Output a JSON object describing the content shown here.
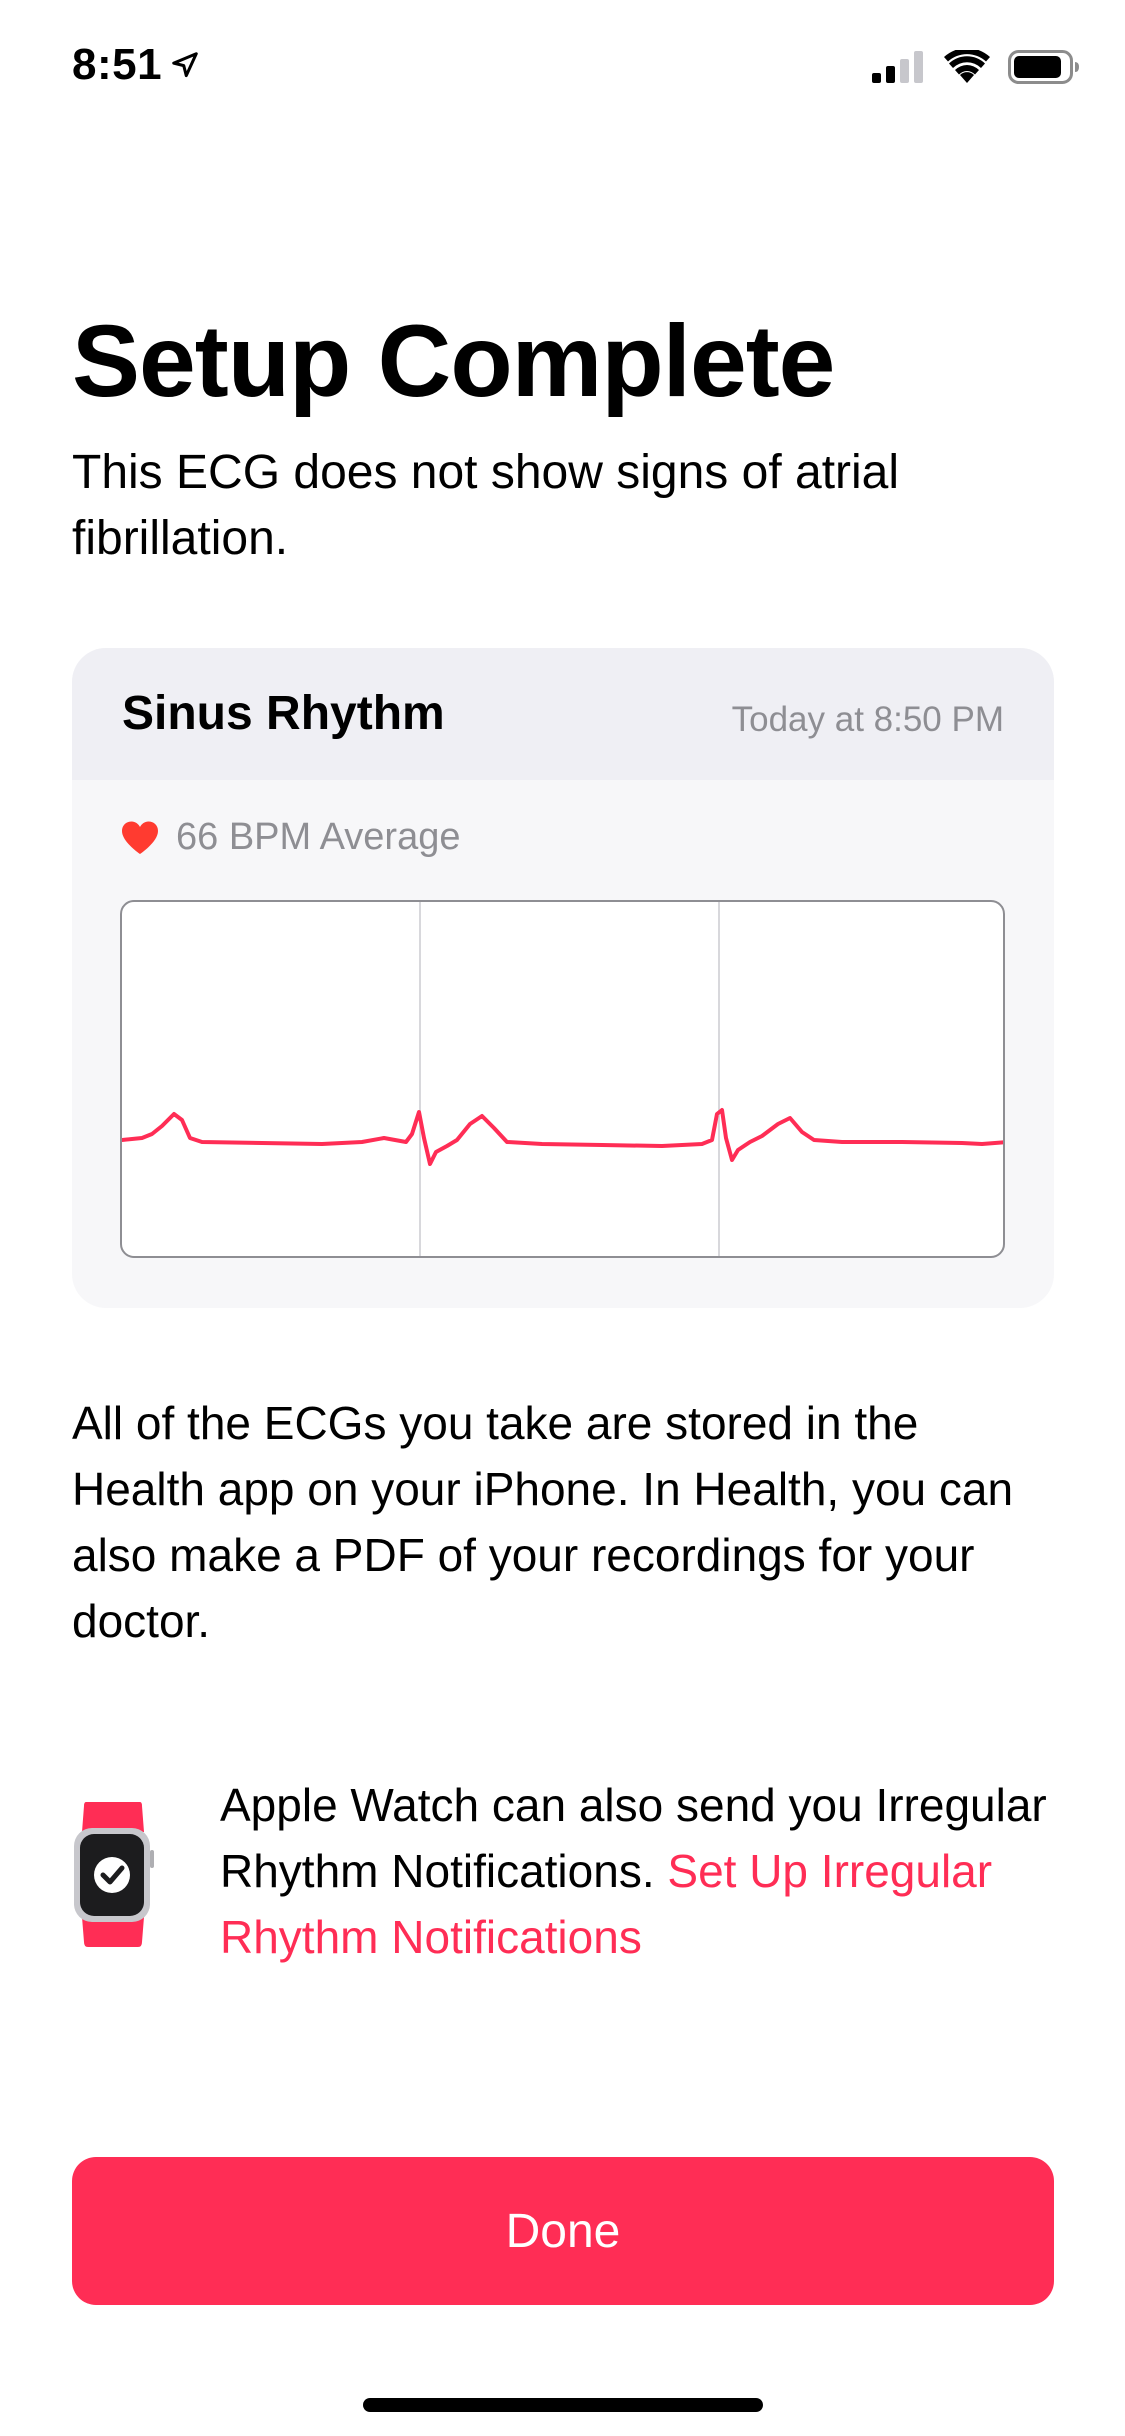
{
  "status_bar": {
    "time": "8:51",
    "icons": [
      "location-arrow-icon",
      "cellular-signal-icon",
      "wifi-icon",
      "battery-icon"
    ]
  },
  "title": "Setup Complete",
  "subtitle": "This ECG does not show signs of atrial fibrillation.",
  "ecg_card": {
    "classification": "Sinus Rhythm",
    "date": "Today at 8:50 PM",
    "bpm_text": "66 BPM Average",
    "heart_icon": "heart-icon",
    "waveform_color": "#ff2d55"
  },
  "info_text": "All of the ECGs you take are stored in the Health app on your iPhone. In Health, you can also make a PDF of your recordings for your doctor.",
  "irregular_rhythm": {
    "icon": "apple-watch-icon",
    "text": "Apple Watch can also send you Irregular Rhythm Notifications. ",
    "link": "Set Up Irregular Rhythm Notifications"
  },
  "done_button": "Done",
  "colors": {
    "accent": "#ff2d55",
    "card_background": "#f7f7f9",
    "card_header": "#efeff4",
    "secondary_text": "#8e8e93"
  }
}
